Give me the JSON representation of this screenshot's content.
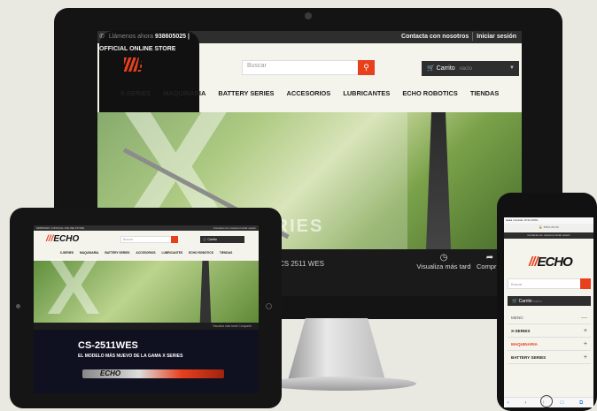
{
  "desktop": {
    "topbar": {
      "phone_label": "Llámenos ahora",
      "phone_number": "938605025",
      "official": "| OFFICIAL ONLINE STORE",
      "contact": "Contacta con nosotros",
      "login": "Iniciar sesión"
    },
    "logo": "ECHO",
    "search_placeholder": "Buscar",
    "cart": {
      "label": "Carrito",
      "status": "vacío"
    },
    "nav": [
      "X-SERIES",
      "MAQUINARIA",
      "BATTERY SERIES",
      "ACCESORIOS",
      "LUBRICANTES",
      "ECHO ROBOTICS",
      "TIENDAS"
    ],
    "hero": {
      "big_letter": "X",
      "series_text": "SERIES"
    },
    "strip": {
      "model": "CS 2511 WES",
      "later": "Visualiza más tard",
      "buy": "Compr"
    }
  },
  "tablet": {
    "topbar": "938605025 | OFFICIAL ONLINE STORE",
    "topbar_right": "Contacta con nosotros  Iniciar sesión",
    "logo": "ECHO",
    "search_placeholder": "Buscar",
    "cart": "Carrito",
    "nav": [
      "X-SERIES",
      "MAQUINARIA",
      "BATTERY SERIES",
      "ACCESORIOS",
      "LUBRICANTES",
      "ECHO ROBOTICS",
      "TIENDAS"
    ],
    "hero_letter": "X",
    "strip_right": "Visualiza más tarde   Compartir",
    "product_title": "CS-2511WES",
    "product_subtitle": "EL MODELO MÁS NUEVO DE LA GAMA X SERIES",
    "bar_logo": "ECHO"
  },
  "phone": {
    "status": "●●●● movistar   10:34   100%",
    "url": "echo-es.es",
    "topbar": "Contacta con nosotros  Iniciar sesión",
    "logo": "ECHO",
    "search_placeholder": "Buscar",
    "cart": {
      "label": "Carrito",
      "status": "vacío"
    },
    "menu": [
      {
        "label": "MENÚ",
        "sign": "—"
      },
      {
        "label": "X-SERIES",
        "sign": "+"
      },
      {
        "label": "MAQUINARIA",
        "sign": "+"
      },
      {
        "label": "BATTERY SERIES",
        "sign": "+"
      }
    ],
    "toolbar": "‹ › ↑ □ ⧉"
  }
}
